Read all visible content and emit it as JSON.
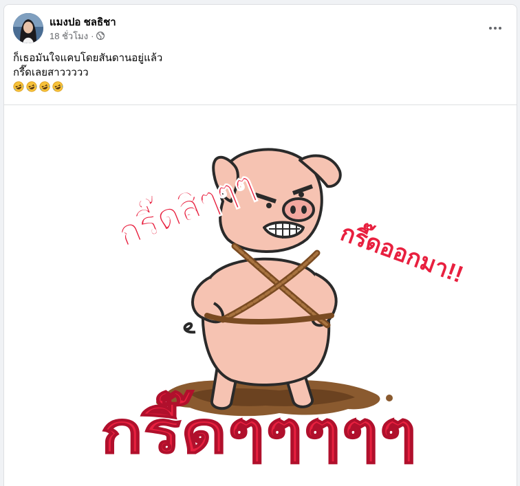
{
  "post": {
    "author_name": "แมงปอ ชลธิชา",
    "timestamp": "18 ชั่วโมง",
    "separator": "·",
    "text_line_1": "ก็เธอมันใจแคบโดยสันดานอยู่แล้ว",
    "text_line_2": "กรี๊ดเลยสาววววว",
    "emoji_name": "rolling-on-floor-laughing",
    "emoji_count": 4
  },
  "image": {
    "caption_top": "กรี๊ดสิๆๆๆ",
    "caption_right": "กรี๊ดออกมา!!",
    "caption_bottom": "กรี๊ดๆๆๆๆๆ",
    "text_color": "#e8203f"
  },
  "icons": {
    "globe": "globe-icon",
    "more": "more-options-icon"
  }
}
